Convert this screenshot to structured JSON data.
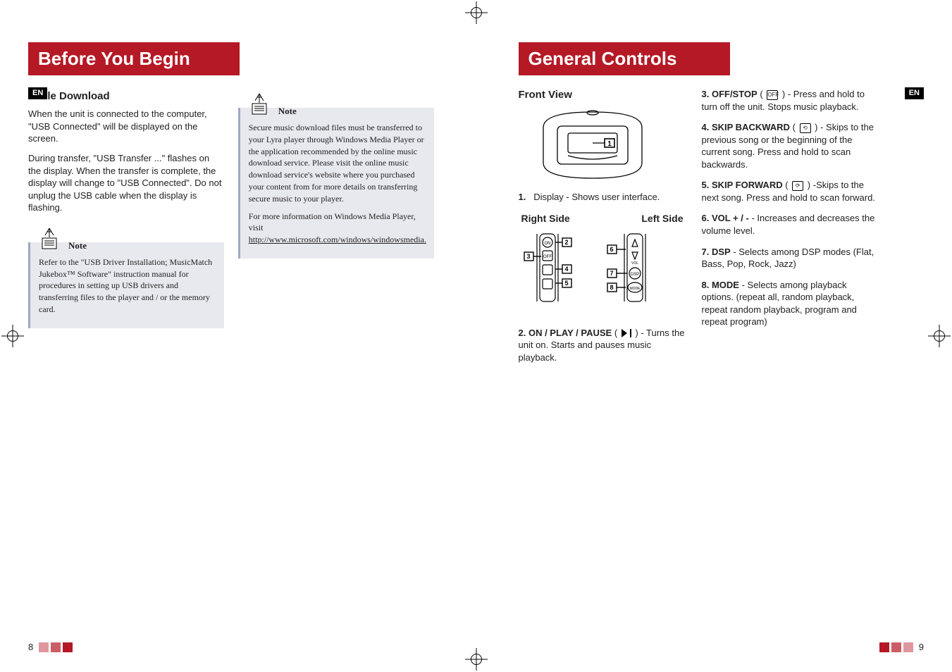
{
  "left": {
    "title": "Before You Begin",
    "lang": "EN",
    "sub": "File Download",
    "p1": "When the unit is connected to the computer, \"USB Connected\" will be displayed on the screen.",
    "p2": "During transfer, \"USB Transfer ...\" flashes on the display.  When the transfer is complete, the display will change to \"USB Connected\". Do not unplug the USB cable when the display is flashing.",
    "note1_label": "Note",
    "note1_body": "Refer to the \"USB Driver Installation; MusicMatch Jukebox™ Software\" instruction manual for procedures in setting up USB drivers and transferring files  to the player and / or the memory card.",
    "note2_label": "Note",
    "note2_p1": "Secure music download files must be transferred to your Lyra player through Windows Media Player or the application recommended by the online music download service. Please visit the online music download service's website where you purchased your content from for more details on transferring secure music to your player.",
    "note2_p2a": "For more information on Windows Media Player, visit ",
    "note2_link": "http://www.microsoft.com/windows/windowsmedia.",
    "page_num": "8"
  },
  "right": {
    "title": "General Controls",
    "lang": "EN",
    "front_view": "Front View",
    "item1_label": "1.",
    "item1_text": "Display - Shows user interface.",
    "right_side": "Right Side",
    "left_side": "Left Side",
    "item2_label": "2.   ON / PLAY / PAUSE",
    "item2_text": " - Turns the unit on.  Starts and pauses music playback.",
    "item3_label": "3.   OFF/STOP",
    "item3_icon": "OFF",
    "item3_text": " - Press and hold to turn off the unit. Stops music playback.",
    "item4_label": "4.   SKIP BACKWARD",
    "item4_text": " - Skips to the previous song or the beginning of the current song. Press and hold to scan backwards.",
    "item5_label": "5.   SKIP FORWARD",
    "item5_text": " -Skips to the next song. Press and hold to scan forward.",
    "item6_label": "6.   VOL + / -",
    "item6_text": "  - Increases and decreases the volume level.",
    "item7_label": "7.   DSP",
    "item7_text": " - Selects among DSP modes (Flat, Bass, Pop, Rock, Jazz)",
    "item8_label": "8.   MODE",
    "item8_text": " - Selects among playback options. (repeat all, random playback, repeat random playback, program and repeat program)",
    "page_num": "9"
  }
}
